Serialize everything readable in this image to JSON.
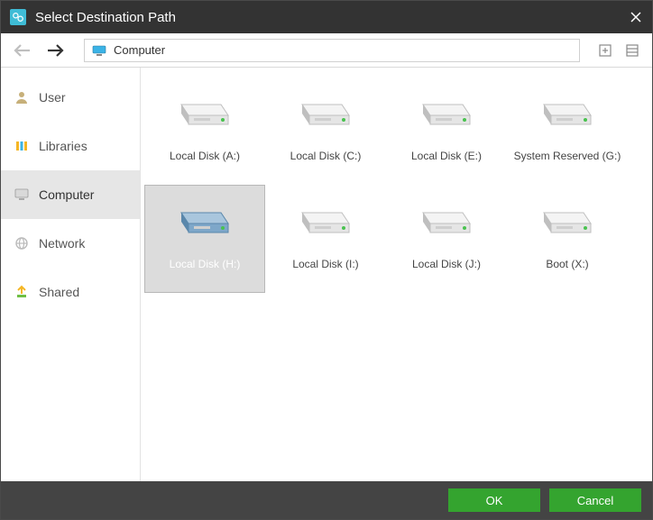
{
  "window": {
    "title": "Select Destination Path"
  },
  "toolbar": {
    "path": "Computer"
  },
  "sidebar": {
    "items": [
      {
        "id": "user",
        "label": "User"
      },
      {
        "id": "libraries",
        "label": "Libraries"
      },
      {
        "id": "computer",
        "label": "Computer"
      },
      {
        "id": "network",
        "label": "Network"
      },
      {
        "id": "shared",
        "label": "Shared"
      }
    ],
    "selected": "computer"
  },
  "content": {
    "items": [
      {
        "id": "a",
        "label": "Local Disk (A:)"
      },
      {
        "id": "c",
        "label": "Local Disk (C:)"
      },
      {
        "id": "e",
        "label": "Local Disk (E:)"
      },
      {
        "id": "g",
        "label": "System Reserved (G:)"
      },
      {
        "id": "h",
        "label": "Local Disk (H:)"
      },
      {
        "id": "i",
        "label": "Local Disk (I:)"
      },
      {
        "id": "j",
        "label": "Local Disk (J:)"
      },
      {
        "id": "x",
        "label": "Boot (X:)"
      }
    ],
    "selected": "h"
  },
  "footer": {
    "ok_label": "OK",
    "cancel_label": "Cancel"
  }
}
